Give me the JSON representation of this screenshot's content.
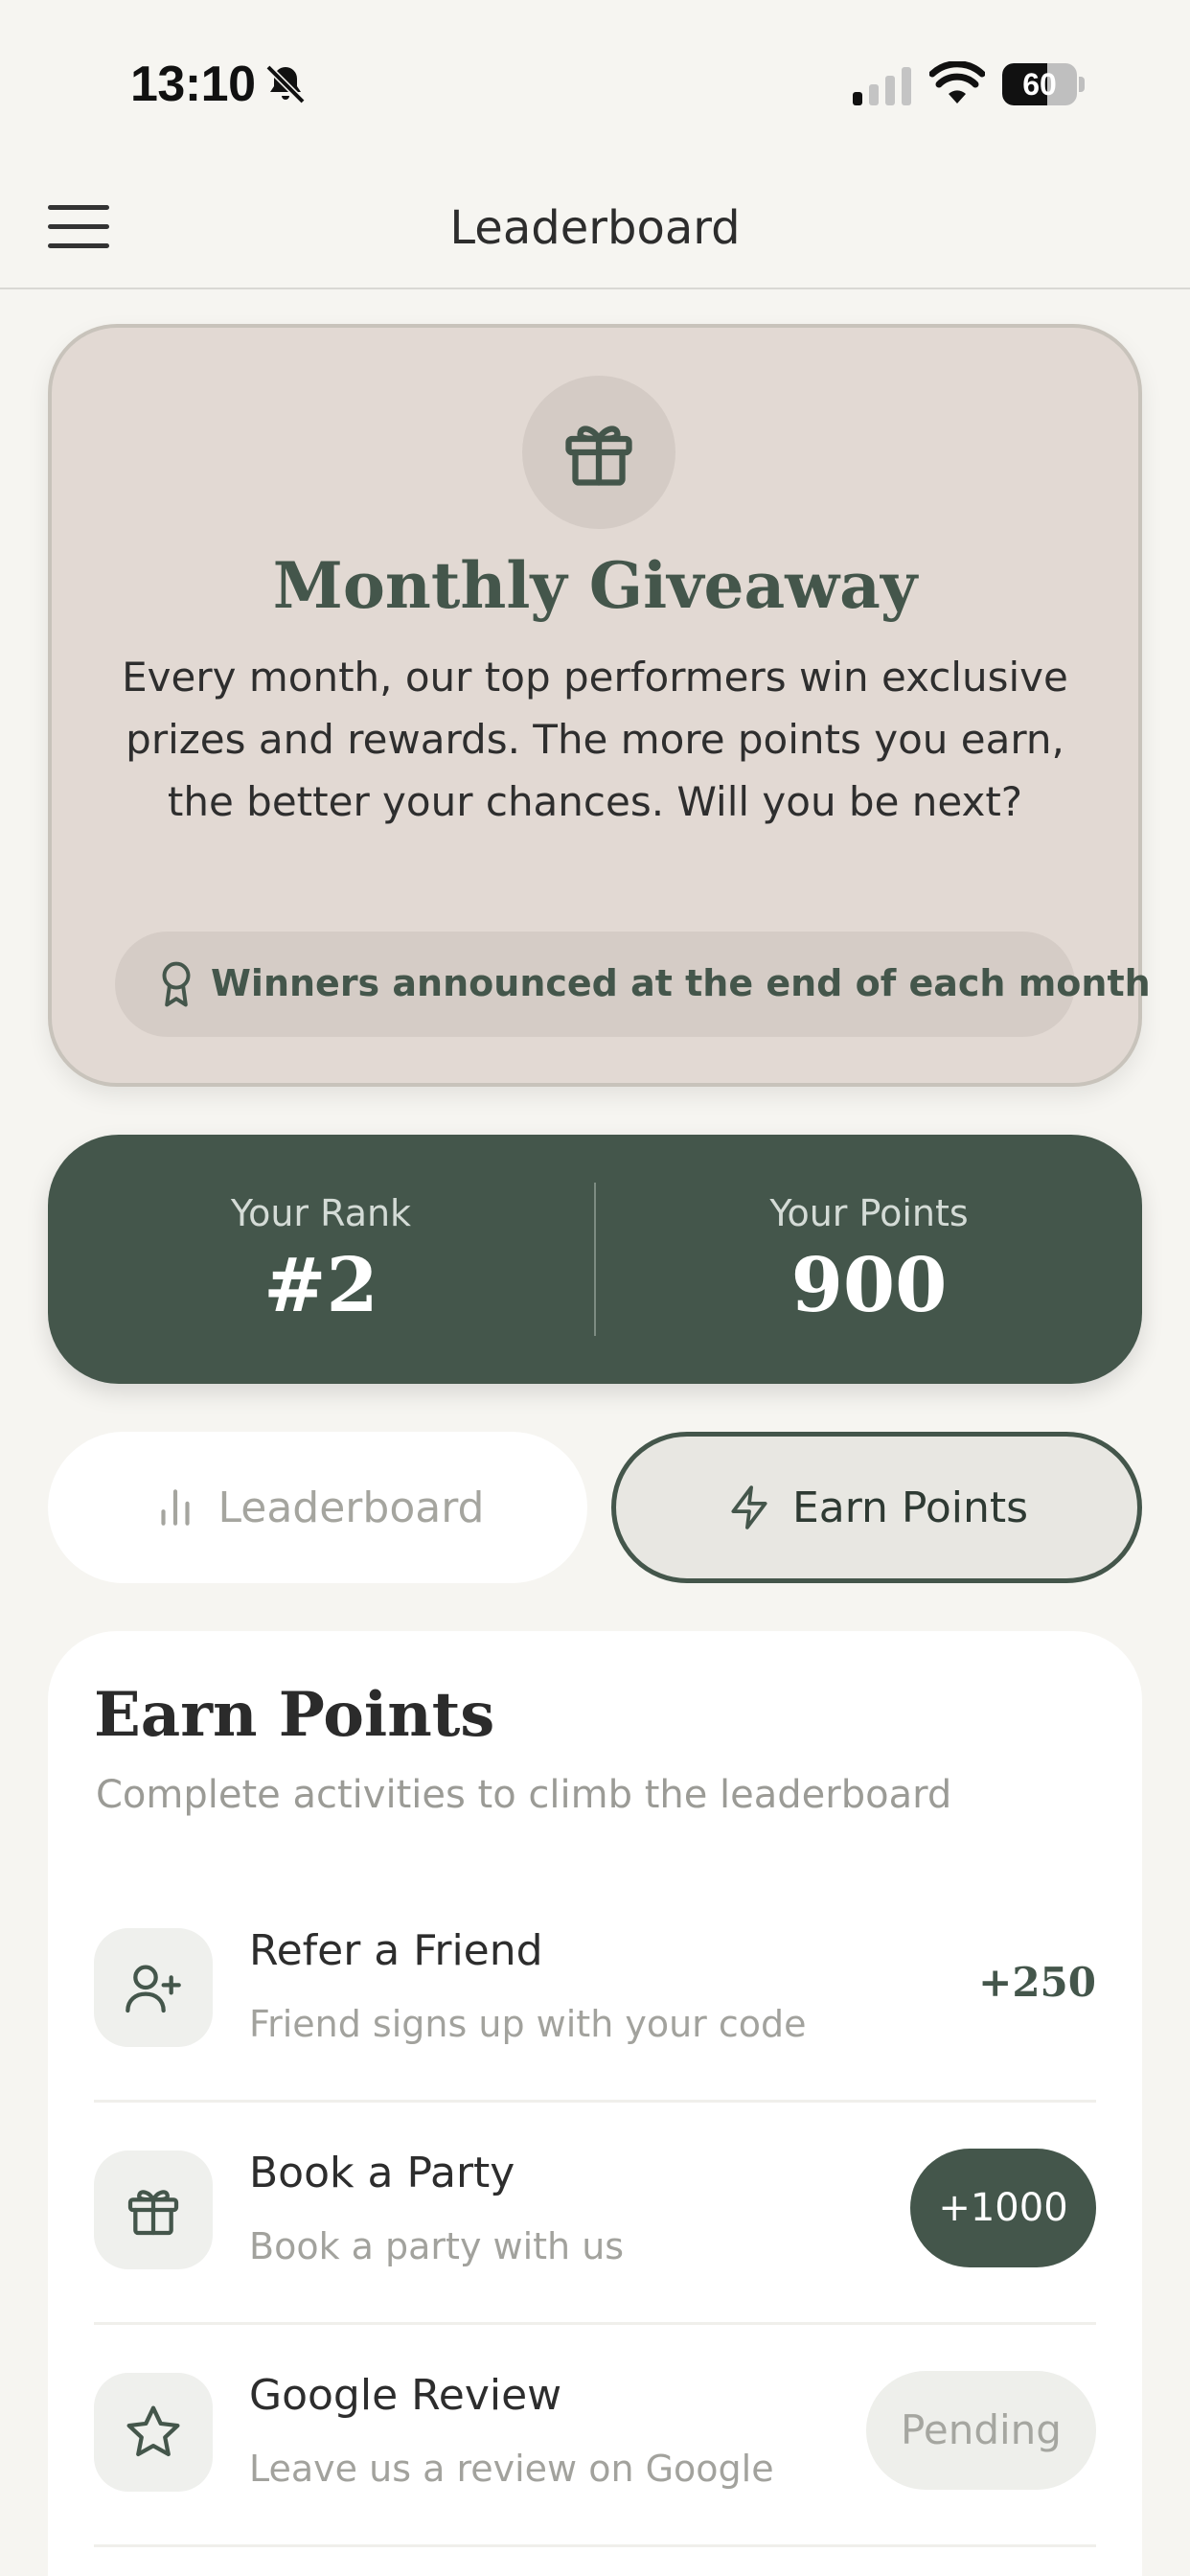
{
  "status_bar": {
    "time": "13:10",
    "battery": "60",
    "battery_level": 0.6,
    "icons": [
      "bell-slash-icon",
      "cellular-signal-icon",
      "wifi-icon",
      "battery-icon"
    ]
  },
  "nav": {
    "title": "Leaderboard",
    "menu_icon": "hamburger-menu-icon"
  },
  "giveaway": {
    "icon": "gift-icon",
    "title": "Monthly Giveaway",
    "description": "Every month, our top performers win exclusive prizes and rewards. The more points you earn, the better your chances. Will you be next?",
    "winners_icon": "award-ribbon-icon",
    "winners_text": "Winners announced at the end of each month"
  },
  "stats": {
    "rank_label": "Your Rank",
    "rank_value": "#2",
    "points_label": "Your Points",
    "points_value": "900"
  },
  "tabs": [
    {
      "label": "Leaderboard",
      "icon": "bar-chart-icon",
      "active": false
    },
    {
      "label": "Earn Points",
      "icon": "lightning-icon",
      "active": true
    }
  ],
  "earn": {
    "title": "Earn Points",
    "subtitle": "Complete activities to climb the leaderboard",
    "activities": [
      {
        "name": "Refer a Friend",
        "description": "Friend signs up with your code",
        "points": "+250",
        "icon": "user-plus-icon"
      },
      {
        "name": "Book a Party",
        "description": "Book a party with us",
        "points": "+1000",
        "icon": "gift-icon"
      },
      {
        "name": "Google Review",
        "description": "Leave us a review on Google",
        "status": "Pending",
        "icon": "star-icon"
      }
    ]
  },
  "colors": {
    "accent": "#44564b",
    "background": "#f6f5f1",
    "card_beige": "#e2d9d3",
    "muted_text": "#a2a29d"
  }
}
